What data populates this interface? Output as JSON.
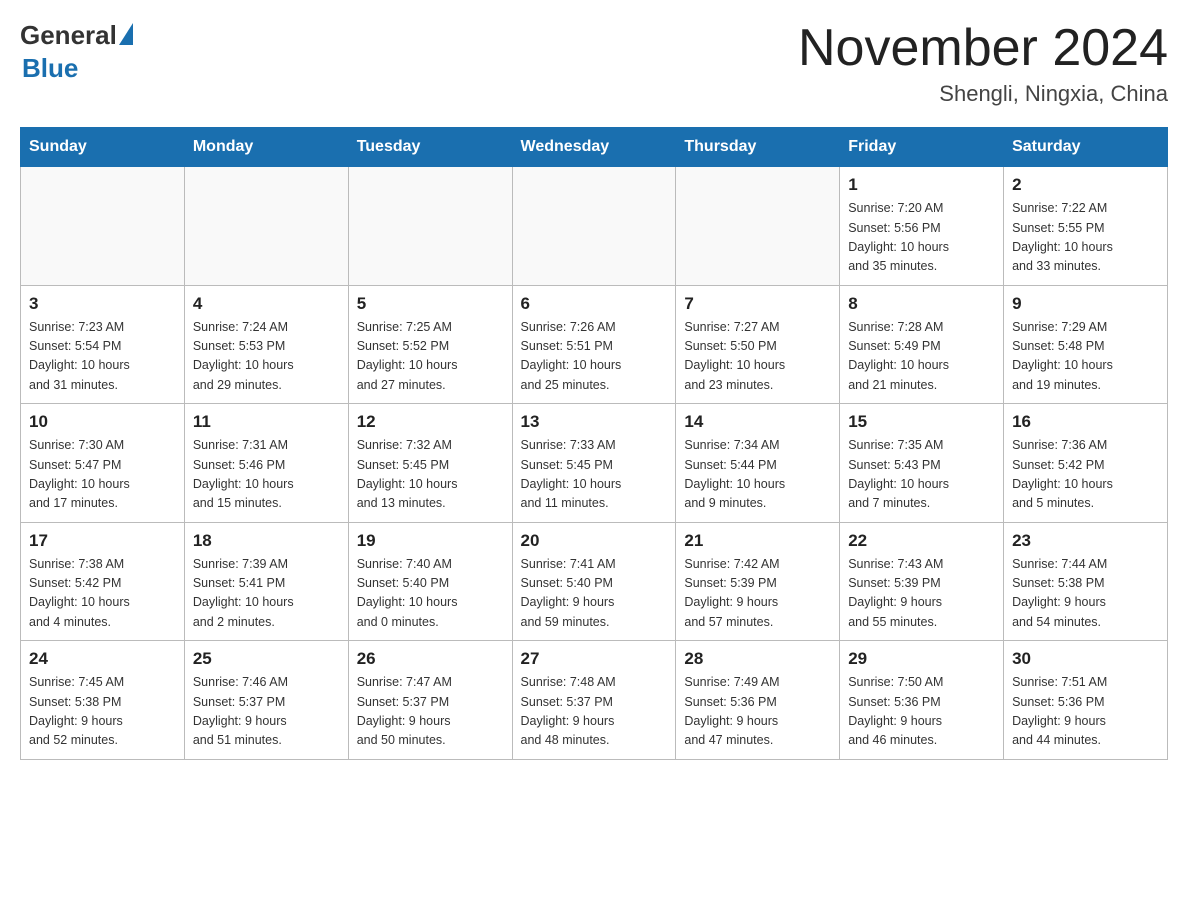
{
  "logo": {
    "general": "General",
    "blue": "Blue"
  },
  "header": {
    "month": "November 2024",
    "location": "Shengli, Ningxia, China"
  },
  "weekdays": [
    "Sunday",
    "Monday",
    "Tuesday",
    "Wednesday",
    "Thursday",
    "Friday",
    "Saturday"
  ],
  "weeks": [
    [
      {
        "day": "",
        "info": ""
      },
      {
        "day": "",
        "info": ""
      },
      {
        "day": "",
        "info": ""
      },
      {
        "day": "",
        "info": ""
      },
      {
        "day": "",
        "info": ""
      },
      {
        "day": "1",
        "info": "Sunrise: 7:20 AM\nSunset: 5:56 PM\nDaylight: 10 hours\nand 35 minutes."
      },
      {
        "day": "2",
        "info": "Sunrise: 7:22 AM\nSunset: 5:55 PM\nDaylight: 10 hours\nand 33 minutes."
      }
    ],
    [
      {
        "day": "3",
        "info": "Sunrise: 7:23 AM\nSunset: 5:54 PM\nDaylight: 10 hours\nand 31 minutes."
      },
      {
        "day": "4",
        "info": "Sunrise: 7:24 AM\nSunset: 5:53 PM\nDaylight: 10 hours\nand 29 minutes."
      },
      {
        "day": "5",
        "info": "Sunrise: 7:25 AM\nSunset: 5:52 PM\nDaylight: 10 hours\nand 27 minutes."
      },
      {
        "day": "6",
        "info": "Sunrise: 7:26 AM\nSunset: 5:51 PM\nDaylight: 10 hours\nand 25 minutes."
      },
      {
        "day": "7",
        "info": "Sunrise: 7:27 AM\nSunset: 5:50 PM\nDaylight: 10 hours\nand 23 minutes."
      },
      {
        "day": "8",
        "info": "Sunrise: 7:28 AM\nSunset: 5:49 PM\nDaylight: 10 hours\nand 21 minutes."
      },
      {
        "day": "9",
        "info": "Sunrise: 7:29 AM\nSunset: 5:48 PM\nDaylight: 10 hours\nand 19 minutes."
      }
    ],
    [
      {
        "day": "10",
        "info": "Sunrise: 7:30 AM\nSunset: 5:47 PM\nDaylight: 10 hours\nand 17 minutes."
      },
      {
        "day": "11",
        "info": "Sunrise: 7:31 AM\nSunset: 5:46 PM\nDaylight: 10 hours\nand 15 minutes."
      },
      {
        "day": "12",
        "info": "Sunrise: 7:32 AM\nSunset: 5:45 PM\nDaylight: 10 hours\nand 13 minutes."
      },
      {
        "day": "13",
        "info": "Sunrise: 7:33 AM\nSunset: 5:45 PM\nDaylight: 10 hours\nand 11 minutes."
      },
      {
        "day": "14",
        "info": "Sunrise: 7:34 AM\nSunset: 5:44 PM\nDaylight: 10 hours\nand 9 minutes."
      },
      {
        "day": "15",
        "info": "Sunrise: 7:35 AM\nSunset: 5:43 PM\nDaylight: 10 hours\nand 7 minutes."
      },
      {
        "day": "16",
        "info": "Sunrise: 7:36 AM\nSunset: 5:42 PM\nDaylight: 10 hours\nand 5 minutes."
      }
    ],
    [
      {
        "day": "17",
        "info": "Sunrise: 7:38 AM\nSunset: 5:42 PM\nDaylight: 10 hours\nand 4 minutes."
      },
      {
        "day": "18",
        "info": "Sunrise: 7:39 AM\nSunset: 5:41 PM\nDaylight: 10 hours\nand 2 minutes."
      },
      {
        "day": "19",
        "info": "Sunrise: 7:40 AM\nSunset: 5:40 PM\nDaylight: 10 hours\nand 0 minutes."
      },
      {
        "day": "20",
        "info": "Sunrise: 7:41 AM\nSunset: 5:40 PM\nDaylight: 9 hours\nand 59 minutes."
      },
      {
        "day": "21",
        "info": "Sunrise: 7:42 AM\nSunset: 5:39 PM\nDaylight: 9 hours\nand 57 minutes."
      },
      {
        "day": "22",
        "info": "Sunrise: 7:43 AM\nSunset: 5:39 PM\nDaylight: 9 hours\nand 55 minutes."
      },
      {
        "day": "23",
        "info": "Sunrise: 7:44 AM\nSunset: 5:38 PM\nDaylight: 9 hours\nand 54 minutes."
      }
    ],
    [
      {
        "day": "24",
        "info": "Sunrise: 7:45 AM\nSunset: 5:38 PM\nDaylight: 9 hours\nand 52 minutes."
      },
      {
        "day": "25",
        "info": "Sunrise: 7:46 AM\nSunset: 5:37 PM\nDaylight: 9 hours\nand 51 minutes."
      },
      {
        "day": "26",
        "info": "Sunrise: 7:47 AM\nSunset: 5:37 PM\nDaylight: 9 hours\nand 50 minutes."
      },
      {
        "day": "27",
        "info": "Sunrise: 7:48 AM\nSunset: 5:37 PM\nDaylight: 9 hours\nand 48 minutes."
      },
      {
        "day": "28",
        "info": "Sunrise: 7:49 AM\nSunset: 5:36 PM\nDaylight: 9 hours\nand 47 minutes."
      },
      {
        "day": "29",
        "info": "Sunrise: 7:50 AM\nSunset: 5:36 PM\nDaylight: 9 hours\nand 46 minutes."
      },
      {
        "day": "30",
        "info": "Sunrise: 7:51 AM\nSunset: 5:36 PM\nDaylight: 9 hours\nand 44 minutes."
      }
    ]
  ]
}
